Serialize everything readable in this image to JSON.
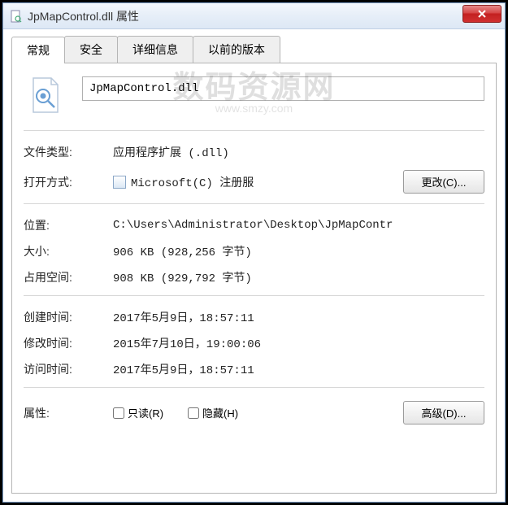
{
  "window": {
    "title": "JpMapControl.dll 属性"
  },
  "tabs": {
    "general": "常规",
    "security": "安全",
    "details": "详细信息",
    "previous": "以前的版本"
  },
  "filename": "JpMapControl.dll",
  "rows": {
    "filetype_label": "文件类型:",
    "filetype_value": "应用程序扩展 (.dll)",
    "openwith_label": "打开方式:",
    "openwith_value": "Microsoft(C) 注册服",
    "change_btn": "更改(C)...",
    "location_label": "位置:",
    "location_value": "C:\\Users\\Administrator\\Desktop\\JpMapContr",
    "size_label": "大小:",
    "size_value": "906 KB (928,256 字节)",
    "sizeondisk_label": "占用空间:",
    "sizeondisk_value": "908 KB (929,792 字节)",
    "created_label": "创建时间:",
    "created_value": "2017年5月9日，18:57:11",
    "modified_label": "修改时间:",
    "modified_value": "2015年7月10日，19:00:06",
    "accessed_label": "访问时间:",
    "accessed_value": "2017年5月9日，18:57:11",
    "attributes_label": "属性:",
    "readonly_label": "只读(R)",
    "hidden_label": "隐藏(H)",
    "advanced_btn": "高级(D)..."
  },
  "watermark": {
    "main": "数码资源网",
    "sub": "www.smzy.com"
  }
}
